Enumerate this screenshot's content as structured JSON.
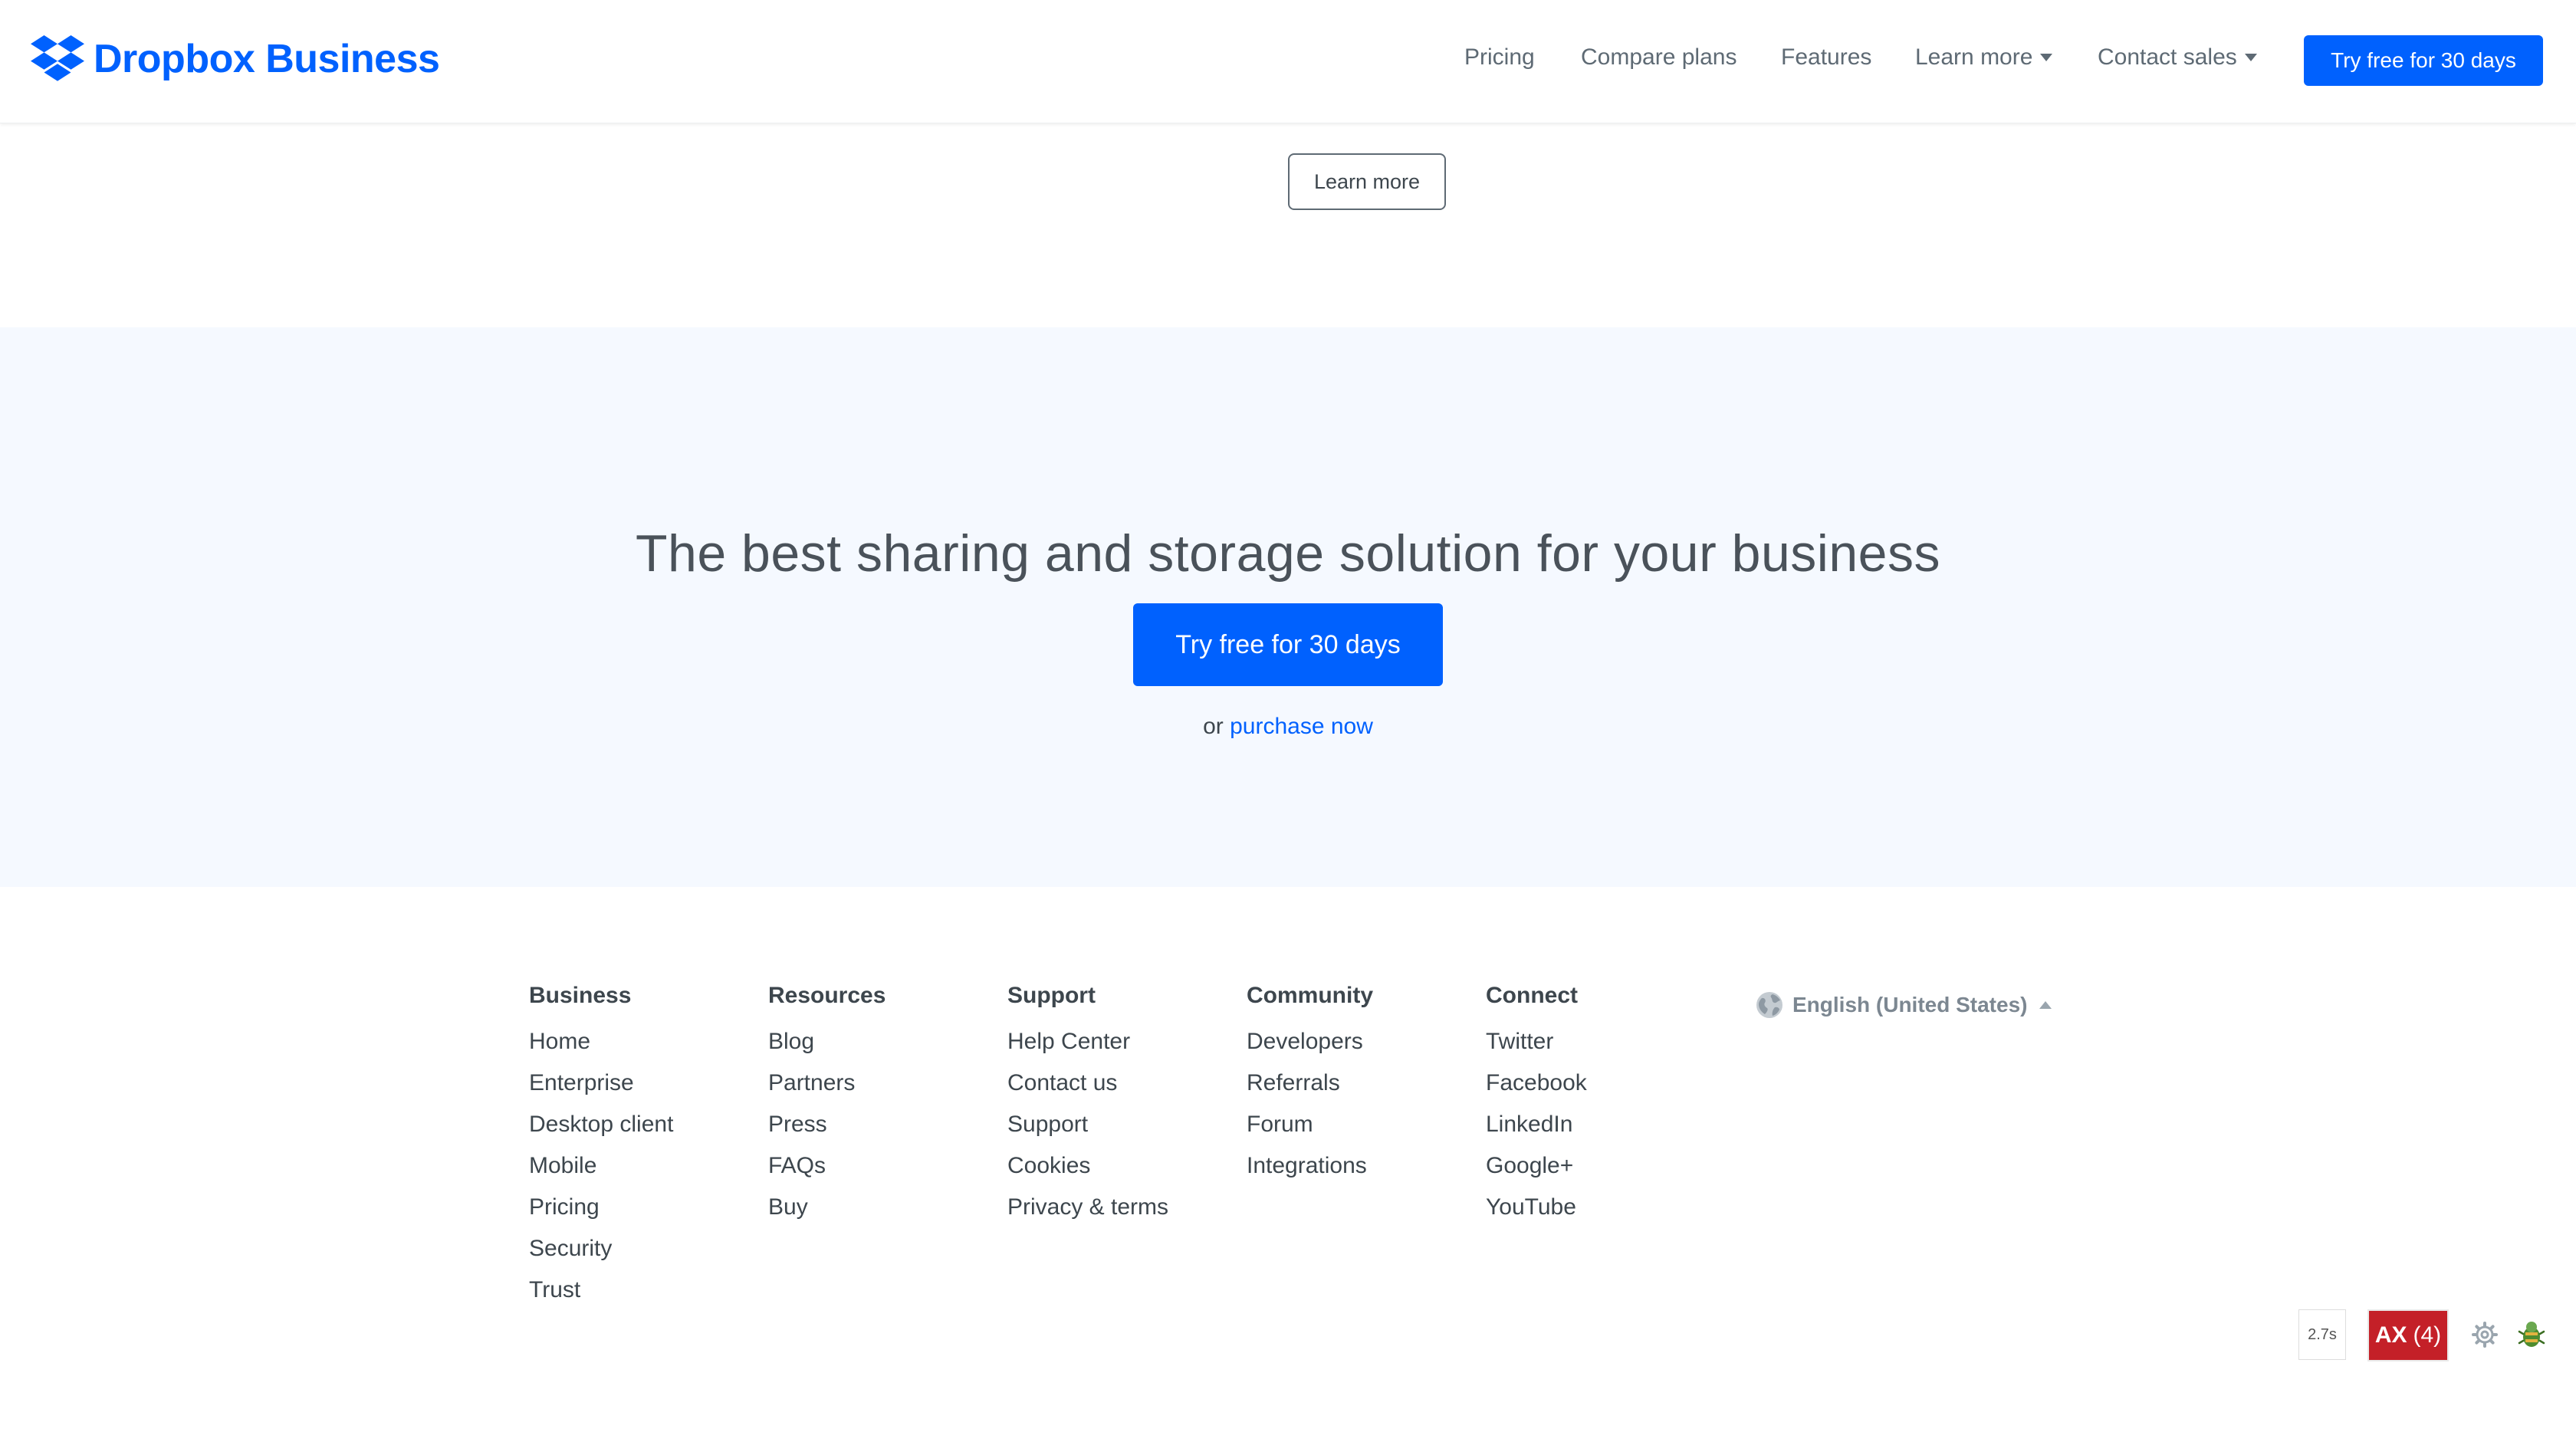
{
  "header": {
    "brand": "Dropbox Business",
    "nav": [
      {
        "label": "Pricing",
        "dropdown": false
      },
      {
        "label": "Compare plans",
        "dropdown": false
      },
      {
        "label": "Features",
        "dropdown": false
      },
      {
        "label": "Learn more",
        "dropdown": true
      },
      {
        "label": "Contact sales",
        "dropdown": true
      }
    ],
    "cta": "Try free for 30 days"
  },
  "section_top": {
    "learn_more": "Learn more"
  },
  "hero": {
    "heading": "The best sharing and storage solution for your business",
    "cta": "Try free for 30 days",
    "sub_prefix": "or ",
    "sub_link": "purchase now"
  },
  "footer": {
    "columns": [
      {
        "title": "Business",
        "items": [
          "Home",
          "Enterprise",
          "Desktop client",
          "Mobile",
          "Pricing",
          "Security",
          "Trust"
        ]
      },
      {
        "title": "Resources",
        "items": [
          "Blog",
          "Partners",
          "Press",
          "FAQs",
          "Buy"
        ]
      },
      {
        "title": "Support",
        "items": [
          "Help Center",
          "Contact us",
          "Support",
          "Cookies",
          "Privacy & terms"
        ]
      },
      {
        "title": "Community",
        "items": [
          "Developers",
          "Referrals",
          "Forum",
          "Integrations"
        ]
      },
      {
        "title": "Connect",
        "items": [
          "Twitter",
          "Facebook",
          "LinkedIn",
          "Google+",
          "YouTube"
        ]
      }
    ],
    "language": "English (United States)"
  },
  "devtools": {
    "timer": "2.7s",
    "ax_label": "AX",
    "ax_count": "(4)"
  },
  "colors": {
    "brand_blue": "#0061fe",
    "hero_bg": "#f5f9ff",
    "ax_red": "#c42028"
  }
}
